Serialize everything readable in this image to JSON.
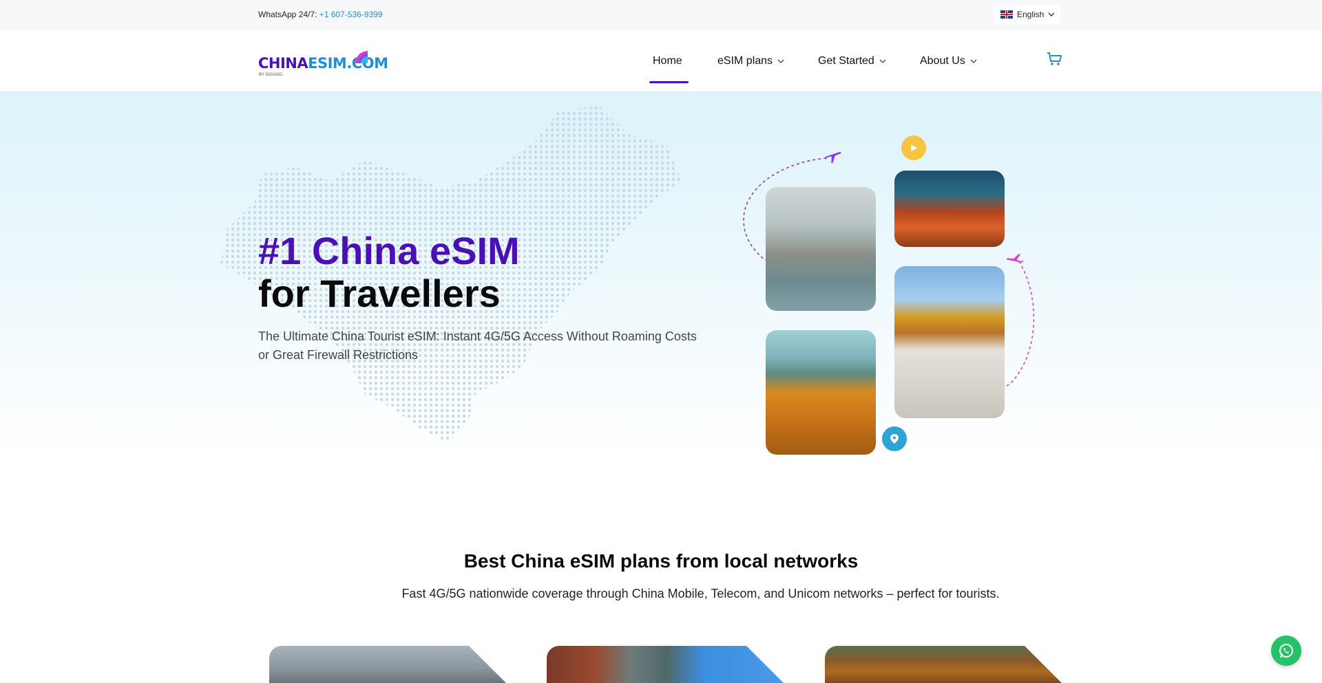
{
  "topbar": {
    "whatsapp_label": "WhatsApp 24/7:",
    "whatsapp_number": "+1 607-536-9399",
    "language": "English"
  },
  "header": {
    "logo_part1": "CHINA",
    "logo_part2": "ESIM.COM",
    "logo_byline": "BY GIGAGO",
    "nav": {
      "home": "Home",
      "esim_plans": "eSIM plans",
      "get_started": "Get Started",
      "about_us": "About Us"
    },
    "active_nav": "Home"
  },
  "hero": {
    "title_line1": "#1 China eSIM",
    "title_line2": "for Travellers",
    "subtitle": "The Ultimate China Tourist eSIM: Instant 4G/5G Access Without Roaming Costs or Great Firewall Restrictions"
  },
  "plans_section": {
    "title": "Best China eSIM plans from local networks",
    "subtitle": "Fast 4G/5G nationwide coverage through China Mobile, Telecom, and Unicom networks – perfect for tourists."
  },
  "icons": [
    "chevron-down-icon",
    "cart-icon",
    "airplane-icon",
    "play-icon",
    "location-pin-icon",
    "whatsapp-icon",
    "uk-flag-icon"
  ],
  "colors": {
    "brand_purple": "#4a10b5",
    "brand_blue": "#1f8fd6",
    "whatsapp_green": "#26c267"
  }
}
